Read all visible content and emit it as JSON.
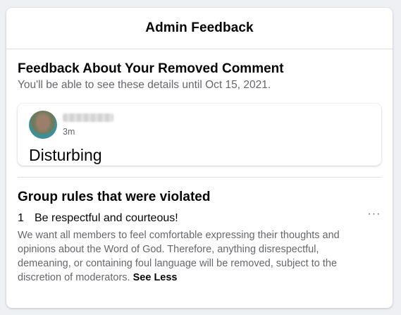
{
  "dialog": {
    "title": "Admin Feedback"
  },
  "feedback": {
    "heading": "Feedback About Your Removed Comment",
    "subtext": "You'll be able to see these details until Oct 15, 2021."
  },
  "comment": {
    "time": "3m",
    "text": "Disturbing"
  },
  "rules": {
    "heading": "Group rules that were violated",
    "items": [
      {
        "number": "1",
        "title": "Be respectful and courteous!",
        "more_label": "···",
        "description": "We want all members to feel comfortable expressing their thoughts and opinions about the Word of God. Therefore, anything disrespectful, demeaning, or containing foul language will be removed, subject to the discretion of moderators.",
        "toggle_label": "See Less"
      }
    ]
  }
}
